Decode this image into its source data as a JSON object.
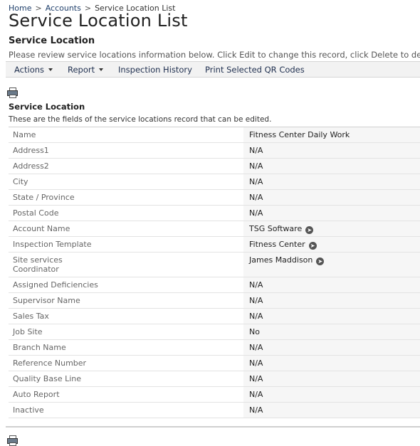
{
  "breadcrumb": {
    "home": "Home",
    "accounts": "Accounts",
    "current": "Service Location List",
    "separator": ">"
  },
  "page_title": "Service Location List",
  "section_title": "Service Location",
  "intro_text": "Please review service locations information below. Click Edit to change this record, click Delete to delete this record.",
  "menu": {
    "actions": "Actions",
    "report": "Report",
    "inspection_history": "Inspection History",
    "print_qr": "Print Selected QR Codes"
  },
  "form": {
    "title": "Service Location",
    "description": "These are the fields of the service locations record that can be edited."
  },
  "fields": [
    {
      "label": "Name",
      "value": "Fitness Center Daily Work"
    },
    {
      "label": "Address1",
      "value": "N/A"
    },
    {
      "label": "Address2",
      "value": "N/A"
    },
    {
      "label": "City",
      "value": "N/A"
    },
    {
      "label": "State / Province",
      "value": "N/A"
    },
    {
      "label": "Postal Code",
      "value": "N/A"
    },
    {
      "label": "Account Name",
      "value": "TSG Software"
    },
    {
      "label": "Inspection Template",
      "value": "Fitness Center"
    },
    {
      "label": "Site services Coordinator",
      "value": "James Maddison"
    },
    {
      "label": "Assigned Deficiencies",
      "value": "N/A"
    },
    {
      "label": "Supervisor Name",
      "value": "N/A"
    },
    {
      "label": "Sales Tax",
      "value": "N/A"
    },
    {
      "label": "Job Site",
      "value": "No"
    },
    {
      "label": "Branch Name",
      "value": "N/A"
    },
    {
      "label": "Reference Number",
      "value": "N/A"
    },
    {
      "label": "Quality Base Line",
      "value": "N/A"
    },
    {
      "label": "Auto Report",
      "value": "N/A"
    },
    {
      "label": "Inactive",
      "value": "N/A"
    }
  ],
  "icons": {
    "print": "printer-icon",
    "go": "arrow-right-circle-icon"
  },
  "colors": {
    "link": "#1f3f6b",
    "menubar_bg": "#f2f2f2",
    "value_bg": "#f6f6f6"
  }
}
